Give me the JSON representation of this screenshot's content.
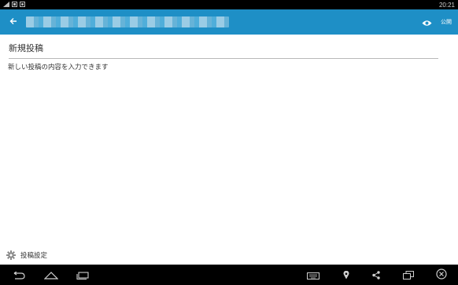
{
  "status_bar": {
    "time": "20:21",
    "icons": [
      "signal-icon",
      "image-icon",
      "photo-icon"
    ]
  },
  "app_bar": {
    "title": "",
    "back_icon": "arrow-left-icon",
    "preview_icon": "eye-icon",
    "publish_label": "公開"
  },
  "editor": {
    "title": "新規投稿",
    "body_placeholder": "新しい投稿の内容を入力できます"
  },
  "settings": {
    "icon": "gear-icon",
    "label": "投稿設定"
  },
  "nav_bar": {
    "icons": [
      "back-icon",
      "home-icon",
      "recent-apps-icon",
      "keyboard-icon",
      "location-icon",
      "share-icon",
      "window-icon",
      "close-circle-icon"
    ]
  },
  "colors": {
    "app_bar": "#1e8fc6",
    "system_bars": "#000000"
  }
}
